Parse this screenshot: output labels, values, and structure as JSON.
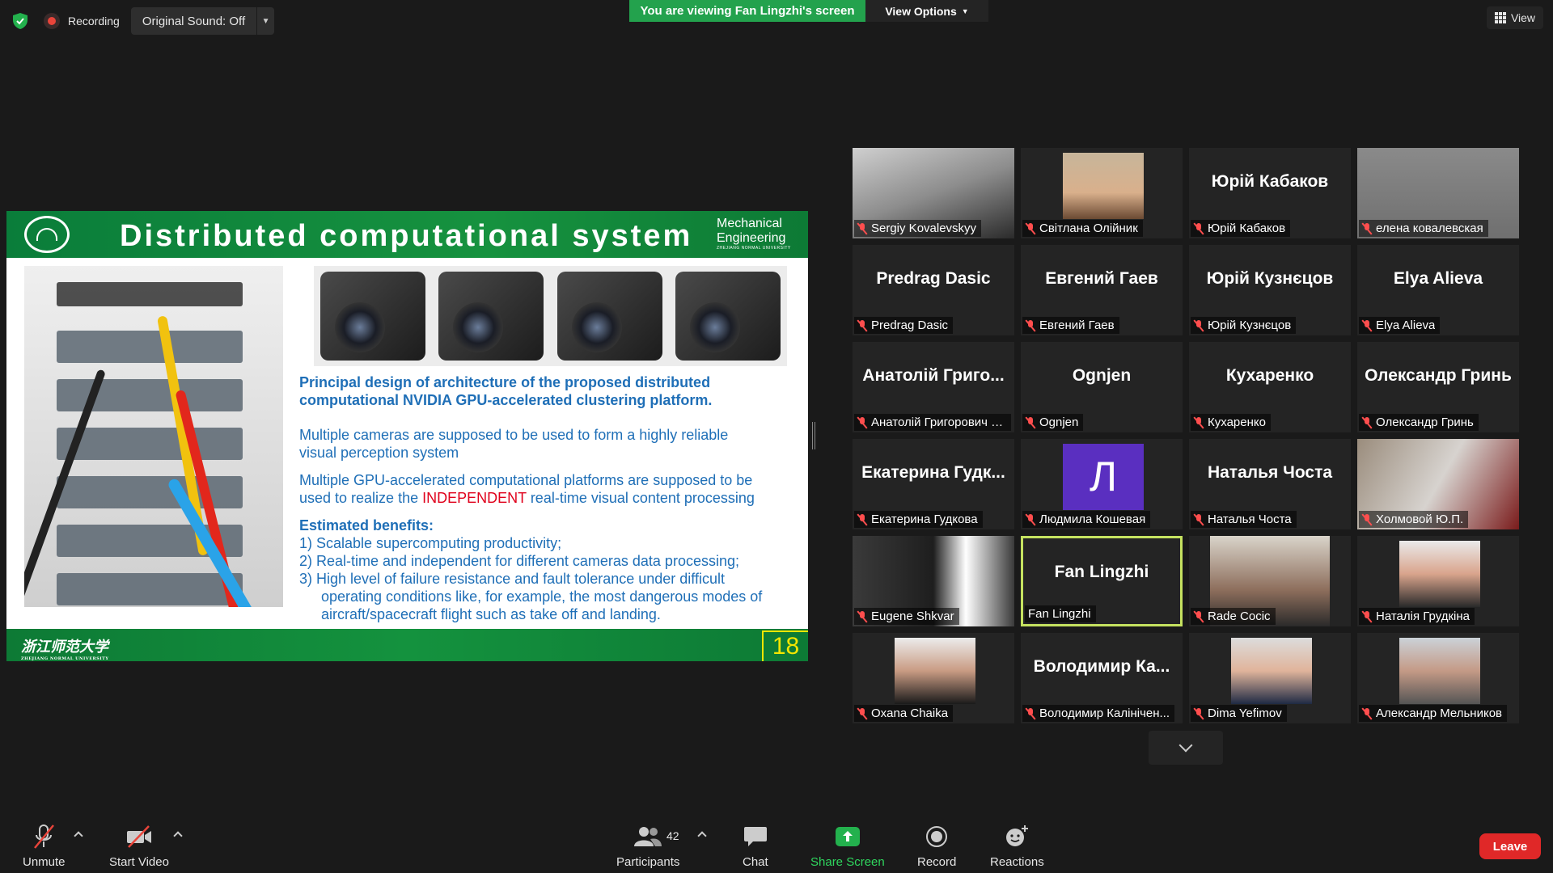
{
  "topbar": {
    "recording_label": "Recording",
    "original_sound": "Original Sound: Off",
    "viewing_banner": "You are viewing Fan Lingzhi's screen",
    "view_options": "View Options",
    "view_label": "View"
  },
  "slide": {
    "title": "Distributed computational system",
    "dept_line1": "Mechanical",
    "dept_line2": "Engineering",
    "dept_small": "ZHEJIANG NORMAL UNIVERSITY",
    "heading1": "Principal design of architecture of the proposed distributed computational NVIDIA GPU-accelerated clustering platform.",
    "para1": "Multiple cameras are supposed to be used to form a highly reliable visual perception system",
    "para2_a": "Multiple GPU-accelerated computational platforms are supposed to be used to realize the ",
    "para2_red": "INDEPENDENT",
    "para2_b": " real-time visual content processing",
    "benefits_heading": "Estimated benefits:",
    "benefits": [
      "1)  Scalable supercomputing productivity;",
      "2)  Real-time and independent for different cameras data processing;",
      "3)  High level of failure resistance and fault tolerance under difficult operating conditions like, for example, the most dangerous modes of aircraft/spacecraft flight such as  take off and landing."
    ],
    "footer_logo": "浙江师范大学",
    "footer_small": "ZHEJIANG NORMAL UNIVERSITY",
    "page_number": "18"
  },
  "participants": [
    {
      "big": "",
      "label": "Sergiy Kovalevskyy"
    },
    {
      "big": "",
      "label": "Світлана Олійник"
    },
    {
      "big": "Юрій Кабаков",
      "label": "Юрій Кабаков"
    },
    {
      "big": "",
      "label": "елена ковалевская"
    },
    {
      "big": "Predrag Dasic",
      "label": "Predrag Dasic"
    },
    {
      "big": "Евгений Гаев",
      "label": "Евгений Гаев"
    },
    {
      "big": "Юрій Кузнєцов",
      "label": "Юрій Кузнєцов"
    },
    {
      "big": "Elya Alieva",
      "label": "Elya Alieva"
    },
    {
      "big": "Анатолій Григо...",
      "label": "Анатолій Григорович Де..."
    },
    {
      "big": "Ognjen",
      "label": "Ognjen"
    },
    {
      "big": "Кухаренко",
      "label": "Кухаренко"
    },
    {
      "big": "Олександр Гринь",
      "label": "Олександр Гринь"
    },
    {
      "big": "Екатерина Гудк...",
      "label": "Екатерина Гудкова"
    },
    {
      "big": "Л",
      "label": "Людмила Кошевая"
    },
    {
      "big": "Наталья Чоста",
      "label": "Наталья Чоста"
    },
    {
      "big": "",
      "label": "Холмовой Ю.П."
    },
    {
      "big": "",
      "label": "Eugene Shkvar"
    },
    {
      "big": "Fan Lingzhi",
      "label": "Fan Lingzhi"
    },
    {
      "big": "",
      "label": "Rade Cocic"
    },
    {
      "big": "",
      "label": "Наталія Грудкіна"
    },
    {
      "big": "",
      "label": "Oxana Chaika"
    },
    {
      "big": "Володимир Ка...",
      "label": "Володимир Калінічен..."
    },
    {
      "big": "",
      "label": "Dima Yefimov"
    },
    {
      "big": "",
      "label": "Александр Мельников"
    }
  ],
  "toolbar": {
    "unmute": "Unmute",
    "start_video": "Start Video",
    "participants": "Participants",
    "participant_count": "42",
    "chat": "Chat",
    "share_screen": "Share Screen",
    "record": "Record",
    "reactions": "Reactions",
    "leave": "Leave"
  },
  "colors": {
    "share_green": "#23a24d",
    "active_speaker": "#c5e260",
    "leave_red": "#e02828",
    "slide_green": "#0d7a35",
    "slide_text_blue": "#1f6fb7"
  }
}
